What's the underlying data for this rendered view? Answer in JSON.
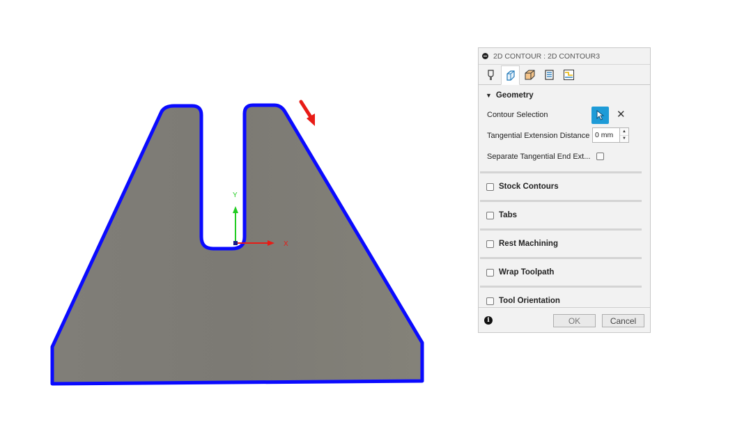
{
  "viewport": {
    "axis_x_label": "X",
    "axis_y_label": "Y",
    "colors": {
      "part_fill": "#7f7d77",
      "contour": "#0a0aff",
      "direction_arrow": "#e81b16",
      "x_axis": "#e81b16",
      "y_axis": "#22cc22"
    }
  },
  "dialog": {
    "title": "2D CONTOUR : 2D CONTOUR3",
    "tabs": [
      {
        "icon": "tool-icon",
        "active": false
      },
      {
        "icon": "geometry-icon",
        "active": true
      },
      {
        "icon": "heights-icon",
        "active": false
      },
      {
        "icon": "passes-icon",
        "active": false
      },
      {
        "icon": "linking-icon",
        "active": false
      }
    ],
    "geometry": {
      "heading": "Geometry",
      "contour_selection_label": "Contour Selection",
      "tangential_extension_label": "Tangential Extension Distance",
      "tangential_extension_value": "0 mm",
      "separate_tangential_label": "Separate Tangential End Ext..."
    },
    "groups": [
      {
        "label": "Stock Contours",
        "checked": false
      },
      {
        "label": "Tabs",
        "checked": false
      },
      {
        "label": "Rest Machining",
        "checked": false
      },
      {
        "label": "Wrap Toolpath",
        "checked": false
      },
      {
        "label": "Tool Orientation",
        "checked": false
      }
    ],
    "buttons": {
      "ok": "OK",
      "cancel": "Cancel"
    },
    "accent_color": "#1e9bd7"
  }
}
